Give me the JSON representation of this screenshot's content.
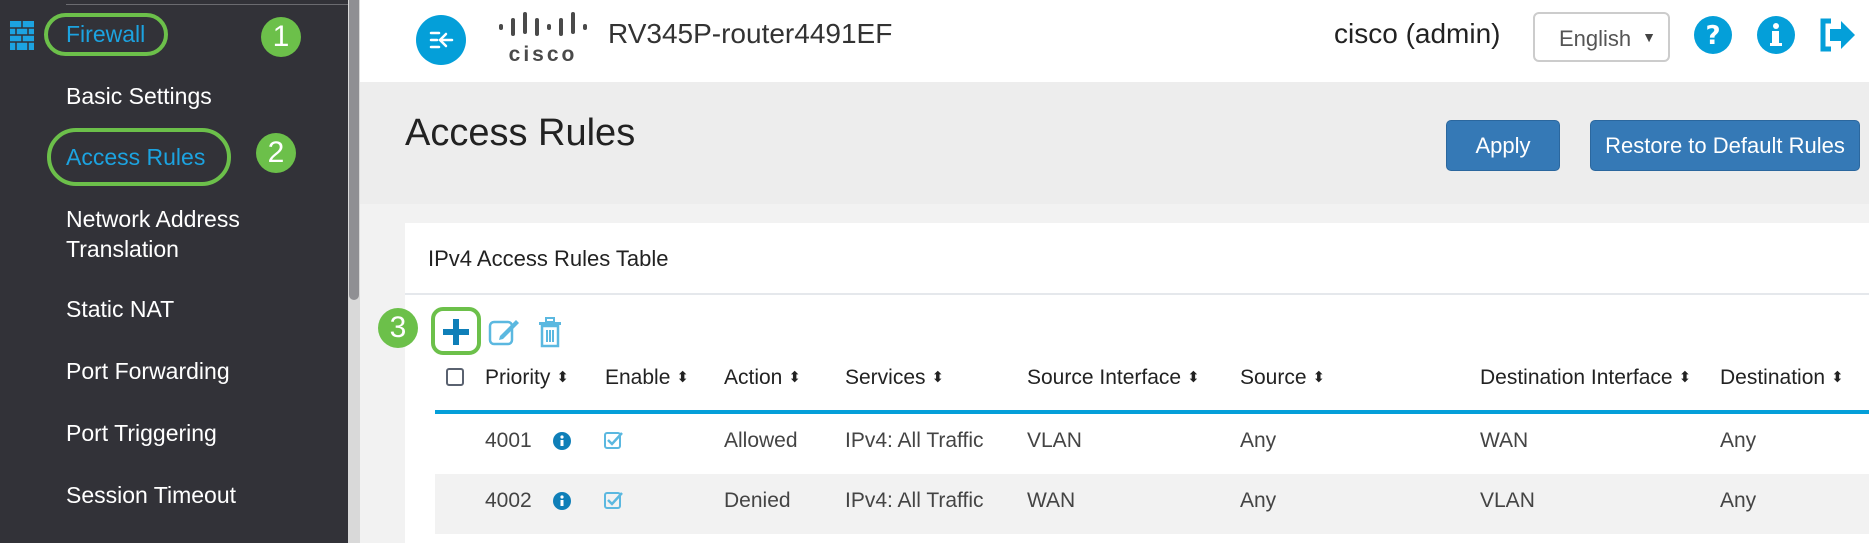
{
  "sidebar": {
    "items": [
      {
        "label": "Firewall",
        "active": true,
        "annotation": "1"
      },
      {
        "label": "Basic Settings"
      },
      {
        "label": "Access Rules",
        "active": true,
        "annotation": "2"
      },
      {
        "label": "Network Address Translation",
        "line1": "Network Address",
        "line2": "Translation"
      },
      {
        "label": "Static NAT"
      },
      {
        "label": "Port Forwarding"
      },
      {
        "label": "Port Triggering"
      },
      {
        "label": "Session Timeout"
      }
    ]
  },
  "header": {
    "brand": "cisco",
    "router_name": "RV345P-router4491EF",
    "user": "cisco (admin)",
    "language": "English",
    "icons": [
      "menu-toggle-icon",
      "help-icon",
      "info-icon",
      "logout-icon"
    ]
  },
  "page": {
    "title": "Access Rules",
    "apply_label": "Apply",
    "restore_label": "Restore to Default Rules"
  },
  "table": {
    "title": "IPv4 Access Rules Table",
    "add_annotation": "3",
    "toolbar": [
      "add-icon",
      "edit-icon",
      "delete-icon"
    ],
    "columns": [
      "Priority",
      "Enable",
      "Action",
      "Services",
      "Source Interface",
      "Source",
      "Destination Interface",
      "Destination"
    ],
    "rows": [
      {
        "priority": "4001",
        "enabled": true,
        "action": "Allowed",
        "services": "IPv4: All Traffic",
        "source_interface": "VLAN",
        "source": "Any",
        "destination_interface": "WAN",
        "destination": "Any"
      },
      {
        "priority": "4002",
        "enabled": true,
        "action": "Denied",
        "services": "IPv4: All Traffic",
        "source_interface": "WAN",
        "source": "Any",
        "destination_interface": "VLAN",
        "destination": "Any"
      }
    ]
  },
  "colors": {
    "accent": "#049fd9",
    "annotation": "#6cc04a",
    "button": "#3579b6",
    "sidebar": "#323238"
  }
}
